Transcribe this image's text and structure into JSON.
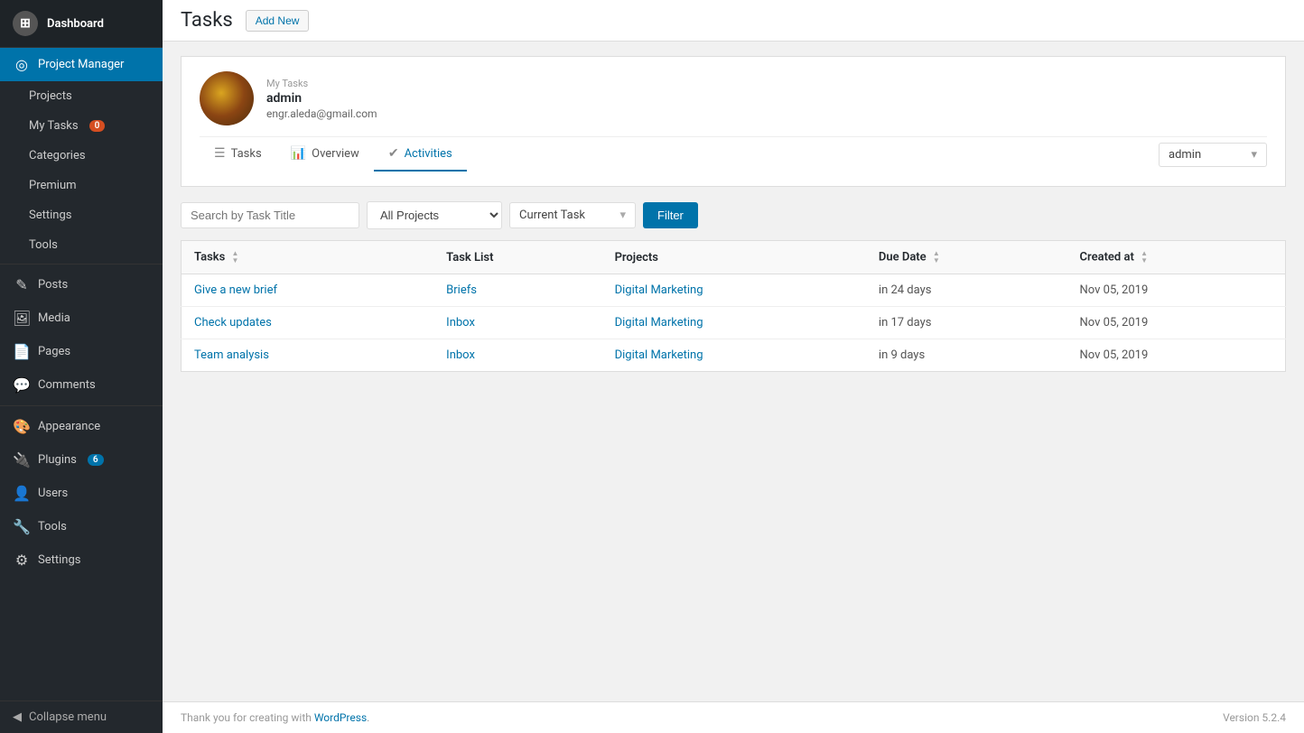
{
  "sidebar": {
    "logo": {
      "label": "Dashboard",
      "icon": "🏠"
    },
    "active_item": "Project Manager",
    "items": [
      {
        "id": "dashboard",
        "label": "Dashboard",
        "icon": "⊞",
        "badge": null
      },
      {
        "id": "project-manager",
        "label": "Project Manager",
        "icon": "◎",
        "badge": null,
        "active": true
      },
      {
        "id": "projects",
        "label": "Projects",
        "icon": "",
        "badge": null,
        "sub": true
      },
      {
        "id": "my-tasks",
        "label": "My Tasks",
        "icon": "",
        "badge": "0",
        "badge_color": "orange",
        "sub": true
      },
      {
        "id": "categories",
        "label": "Categories",
        "icon": "",
        "badge": null,
        "sub": true
      },
      {
        "id": "premium",
        "label": "Premium",
        "icon": "",
        "badge": null,
        "sub": true
      },
      {
        "id": "settings-pm",
        "label": "Settings",
        "icon": "",
        "badge": null,
        "sub": true
      },
      {
        "id": "tools-pm",
        "label": "Tools",
        "icon": "",
        "badge": null,
        "sub": true
      },
      {
        "id": "posts",
        "label": "Posts",
        "icon": "✎",
        "badge": null
      },
      {
        "id": "media",
        "label": "Media",
        "icon": "🖼",
        "badge": null
      },
      {
        "id": "pages",
        "label": "Pages",
        "icon": "📄",
        "badge": null
      },
      {
        "id": "comments",
        "label": "Comments",
        "icon": "💬",
        "badge": null
      },
      {
        "id": "appearance",
        "label": "Appearance",
        "icon": "🎨",
        "badge": null
      },
      {
        "id": "plugins",
        "label": "Plugins",
        "icon": "🔌",
        "badge": "6",
        "badge_color": "blue"
      },
      {
        "id": "users",
        "label": "Users",
        "icon": "👤",
        "badge": null
      },
      {
        "id": "tools",
        "label": "Tools",
        "icon": "🔧",
        "badge": null
      },
      {
        "id": "settings",
        "label": "Settings",
        "icon": "⚙",
        "badge": null
      }
    ],
    "collapse_label": "Collapse menu"
  },
  "header": {
    "title": "Tasks",
    "add_new_label": "Add New"
  },
  "profile": {
    "section_label": "My Tasks",
    "name": "admin",
    "email": "engr.aleda@gmail.com"
  },
  "tabs": [
    {
      "id": "tasks",
      "label": "Tasks",
      "icon": "☰",
      "active": false
    },
    {
      "id": "overview",
      "label": "Overview",
      "icon": "📊",
      "active": false
    },
    {
      "id": "activities",
      "label": "Activities",
      "icon": "✔",
      "active": true
    }
  ],
  "admin_dropdown": {
    "value": "admin",
    "options": [
      "admin"
    ]
  },
  "filter": {
    "search_placeholder": "Search by Task Title",
    "projects_default": "All Projects",
    "task_status": "Current Task",
    "filter_button_label": "Filter"
  },
  "table": {
    "columns": [
      {
        "id": "tasks",
        "label": "Tasks"
      },
      {
        "id": "task_list",
        "label": "Task List"
      },
      {
        "id": "projects",
        "label": "Projects"
      },
      {
        "id": "due_date",
        "label": "Due Date"
      },
      {
        "id": "created_at",
        "label": "Created at"
      }
    ],
    "rows": [
      {
        "task": "Give a new brief",
        "task_list": "Briefs",
        "project": "Digital Marketing",
        "due_date": "in 24 days",
        "created_at": "Nov 05, 2019"
      },
      {
        "task": "Check updates",
        "task_list": "Inbox",
        "project": "Digital Marketing",
        "due_date": "in 17 days",
        "created_at": "Nov 05, 2019"
      },
      {
        "task": "Team analysis",
        "task_list": "Inbox",
        "project": "Digital Marketing",
        "due_date": "in 9 days",
        "created_at": "Nov 05, 2019"
      }
    ]
  },
  "footer": {
    "thank_you_prefix": "Thank you for creating with ",
    "wordpress_label": "WordPress",
    "thank_you_suffix": ".",
    "version": "Version 5.2.4"
  }
}
